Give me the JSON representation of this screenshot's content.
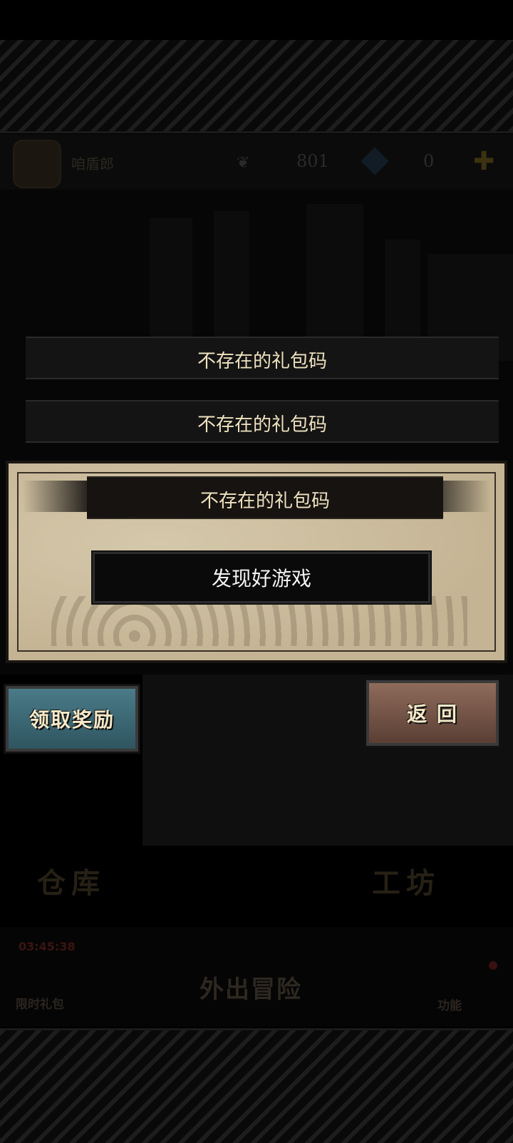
{
  "header": {
    "player_name": "咱盾郎",
    "coins": "801",
    "gems": "0",
    "plus_icon": "plus-icon"
  },
  "gift_codes": {
    "history": [
      "不存在的礼包码",
      "不存在的礼包码"
    ],
    "current_message": "不存在的礼包码",
    "input_value": "发现好游戏"
  },
  "buttons": {
    "claim": "领取奖励",
    "back": "返 回"
  },
  "background_labels": {
    "warehouse": "仓库",
    "workshop": "工坊"
  },
  "bottom_nav": {
    "timer": "03:45:38",
    "limited_gift": "限时礼包",
    "adventure": "外出冒险",
    "functions": "功能"
  },
  "colors": {
    "claim_button": "#3e6b78",
    "back_button": "#7a5a4c",
    "message_text": "#efe2bf",
    "panel_paper": "#cbbd9f"
  }
}
